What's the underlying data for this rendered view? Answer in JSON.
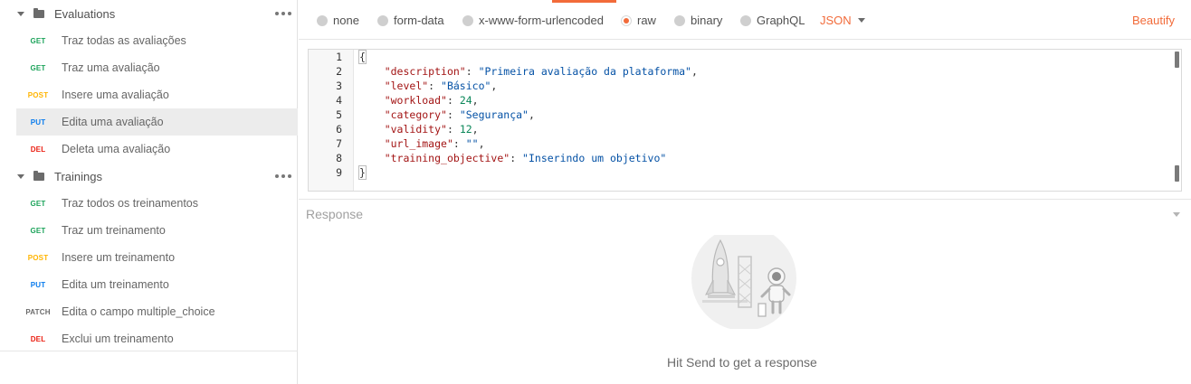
{
  "sidebar": {
    "folders": [
      {
        "name": "Evaluations"
      },
      {
        "name": "Trainings"
      }
    ],
    "evaluations": [
      {
        "method": "GET",
        "name": "Traz todas as avaliações"
      },
      {
        "method": "GET",
        "name": "Traz uma avaliação"
      },
      {
        "method": "POST",
        "name": "Insere uma avaliação"
      },
      {
        "method": "PUT",
        "name": "Edita uma avaliação"
      },
      {
        "method": "DEL",
        "name": "Deleta uma avaliação"
      }
    ],
    "trainings": [
      {
        "method": "GET",
        "name": "Traz todos os treinamentos"
      },
      {
        "method": "GET",
        "name": "Traz um treinamento"
      },
      {
        "method": "POST",
        "name": "Insere um treinamento"
      },
      {
        "method": "PUT",
        "name": "Edita um treinamento"
      },
      {
        "method": "PATCH",
        "name": "Edita o campo multiple_choice"
      },
      {
        "method": "DEL",
        "name": "Exclui um treinamento"
      }
    ]
  },
  "body_types": {
    "none": "none",
    "form_data": "form-data",
    "urlencoded": "x-www-form-urlencoded",
    "raw": "raw",
    "binary": "binary",
    "graphql": "GraphQL",
    "selected": "raw"
  },
  "format_select": "JSON",
  "beautify_label": "Beautify",
  "editor": {
    "line_numbers": [
      "1",
      "2",
      "3",
      "4",
      "5",
      "6",
      "7",
      "8",
      "9"
    ],
    "open_brace": "{",
    "close_brace": "}",
    "fields": [
      {
        "key": "\"description\"",
        "value": "\"Primeira avaliação da plataforma\"",
        "value_type": "string",
        "trail": ","
      },
      {
        "key": "\"level\"",
        "value": "\"Básico\"",
        "value_type": "string",
        "trail": ","
      },
      {
        "key": "\"workload\"",
        "value": "24",
        "value_type": "number",
        "trail": ","
      },
      {
        "key": "\"category\"",
        "value": "\"Segurança\"",
        "value_type": "string",
        "trail": ","
      },
      {
        "key": "\"validity\"",
        "value": "12",
        "value_type": "number",
        "trail": ","
      },
      {
        "key": "\"url_image\"",
        "value": "\"\"",
        "value_type": "string",
        "trail": ","
      },
      {
        "key": "\"training_objective\"",
        "value": "\"Inserindo um objetivo\"",
        "value_type": "string",
        "trail": ""
      }
    ]
  },
  "response": {
    "label": "Response",
    "hint": "Hit Send to get a response"
  },
  "colors": {
    "accent": "#f26b3a",
    "get": "#1ca35a",
    "post": "#ffb400",
    "put": "#097bed",
    "del": "#eb2013",
    "patch": "#6b6b6b"
  },
  "icons": {
    "folder": "folder-icon",
    "more": "more-icon",
    "caret": "chevron-down-icon",
    "illustration": "rocket-astronaut-illustration"
  }
}
